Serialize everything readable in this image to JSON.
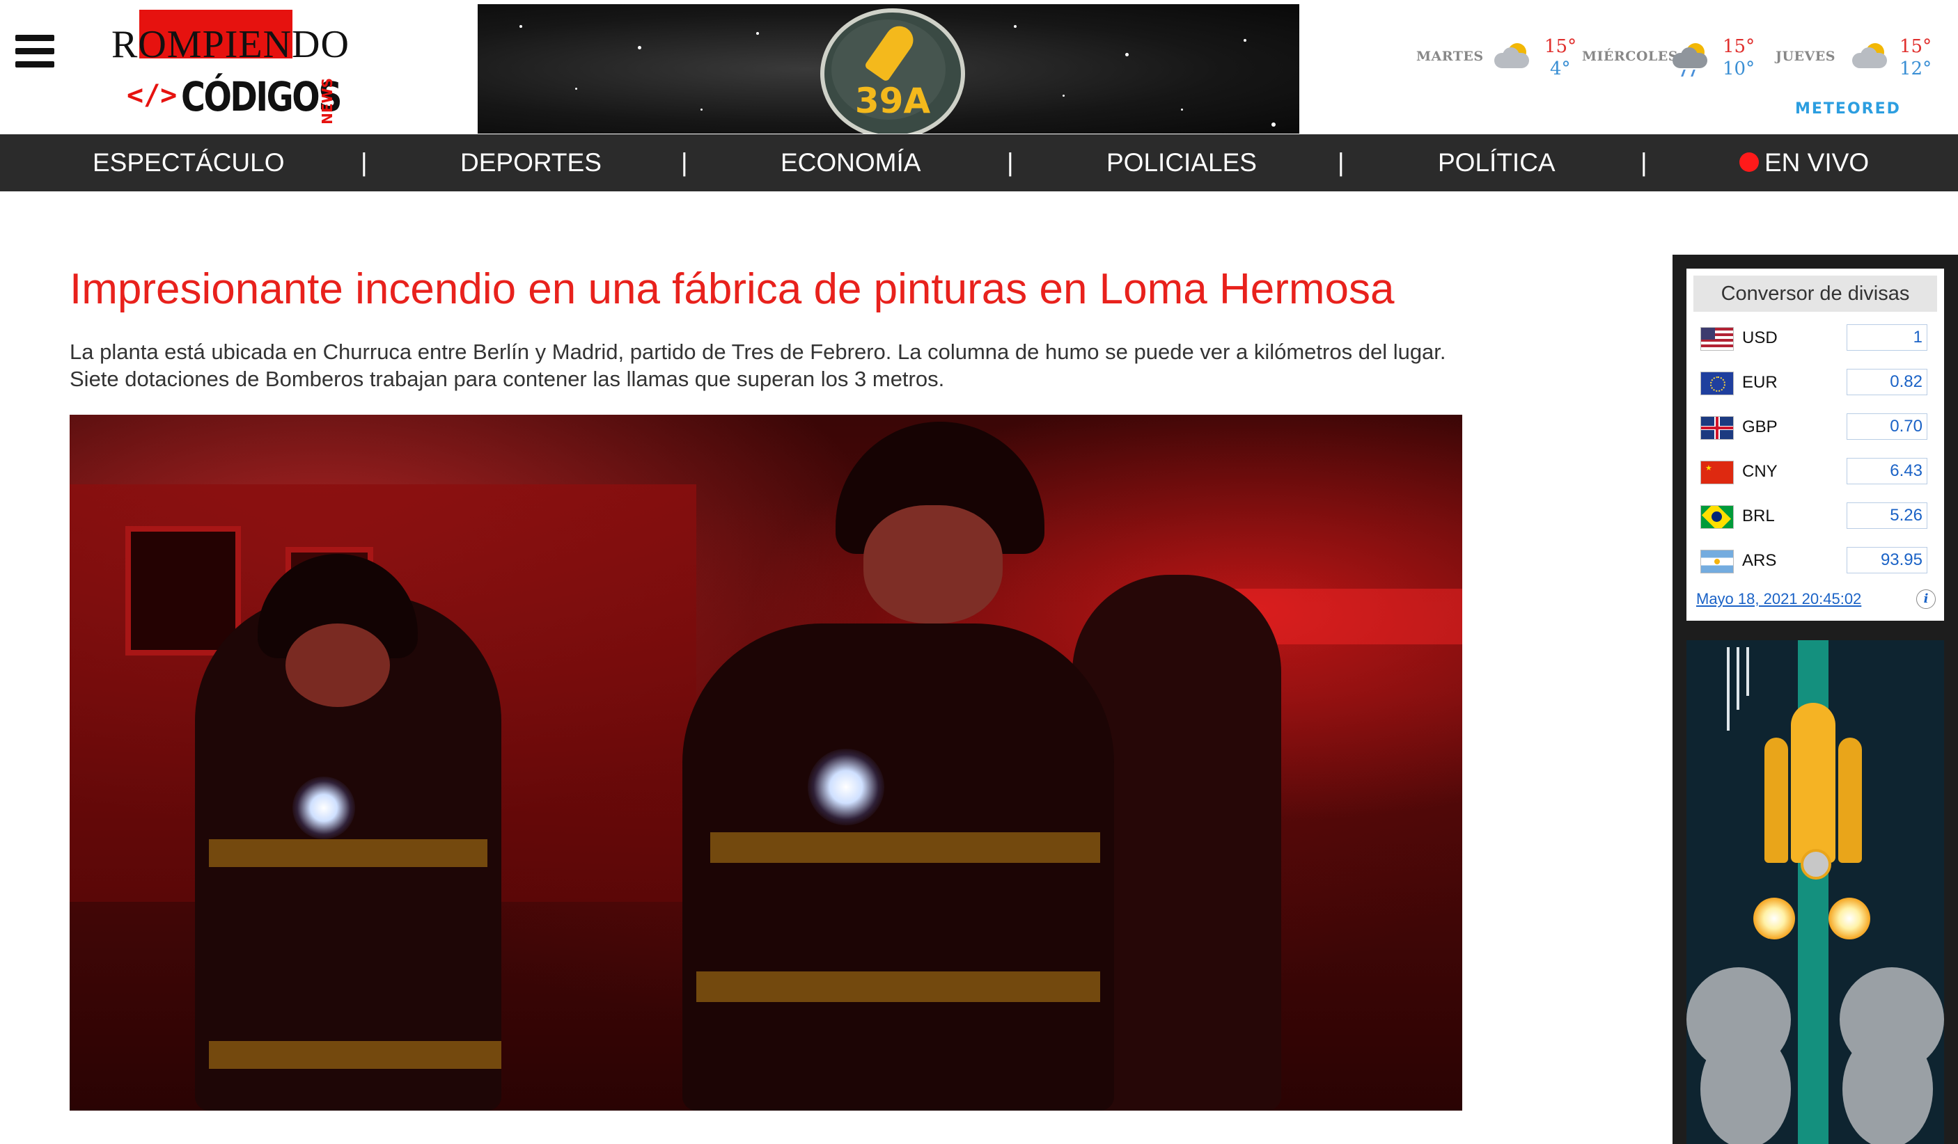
{
  "header": {
    "menu_icon": "hamburger-menu-icon",
    "logo": {
      "line1": "ROMPIENDO",
      "code_symbol": "</>",
      "line2": "CÓDIGOS",
      "badge": "NEWS"
    },
    "banner": {
      "badge_text": "39A",
      "icon": "rocket-badge-icon"
    },
    "weather": {
      "days": [
        {
          "day": "MARTES",
          "icon": "partly-cloudy-icon",
          "high": "15°",
          "low": "4°"
        },
        {
          "day": "MIÉRCOLES",
          "icon": "cloud-rain-icon",
          "high": "15°",
          "low": "10°"
        },
        {
          "day": "JUEVES",
          "icon": "partly-cloudy-icon",
          "high": "15°",
          "low": "12°"
        }
      ],
      "provider": "METEORED"
    }
  },
  "nav": {
    "items": [
      {
        "label": "ESPECTÁCULO"
      },
      {
        "label": "DEPORTES"
      },
      {
        "label": "ECONOMÍA"
      },
      {
        "label": "POLICIALES"
      },
      {
        "label": "POLÍTICA"
      },
      {
        "label": "EN VIVO",
        "live": true
      }
    ],
    "separator": "|"
  },
  "article": {
    "headline": "Impresionante incendio en una fábrica de pinturas en Loma Hermosa",
    "summary": "La planta está ubicada en Churruca entre Berlín y Madrid, partido de Tres de Febrero. La columna de humo se puede ver a kilómetros del lugar. Siete dotaciones de Bomberos trabajan para contener las llamas que superan los 3 metros."
  },
  "sidebar": {
    "converter": {
      "title": "Conversor de divisas",
      "rows": [
        {
          "code": "USD",
          "value": "1",
          "flag": "us-flag-icon"
        },
        {
          "code": "EUR",
          "value": "0.82",
          "flag": "eu-flag-icon"
        },
        {
          "code": "GBP",
          "value": "0.70",
          "flag": "uk-flag-icon"
        },
        {
          "code": "CNY",
          "value": "6.43",
          "flag": "cn-flag-icon"
        },
        {
          "code": "BRL",
          "value": "5.26",
          "flag": "br-flag-icon"
        },
        {
          "code": "ARS",
          "value": "93.95",
          "flag": "ar-flag-icon"
        }
      ],
      "date": "Mayo 18, 2021 20:45:02",
      "info": "i"
    }
  },
  "colors": {
    "brand_red": "#e6120f",
    "headline_red": "#e8211c",
    "nav_bg": "#2b2b2b",
    "link_blue": "#1a62c6",
    "live_dot": "#ff1a1a"
  }
}
